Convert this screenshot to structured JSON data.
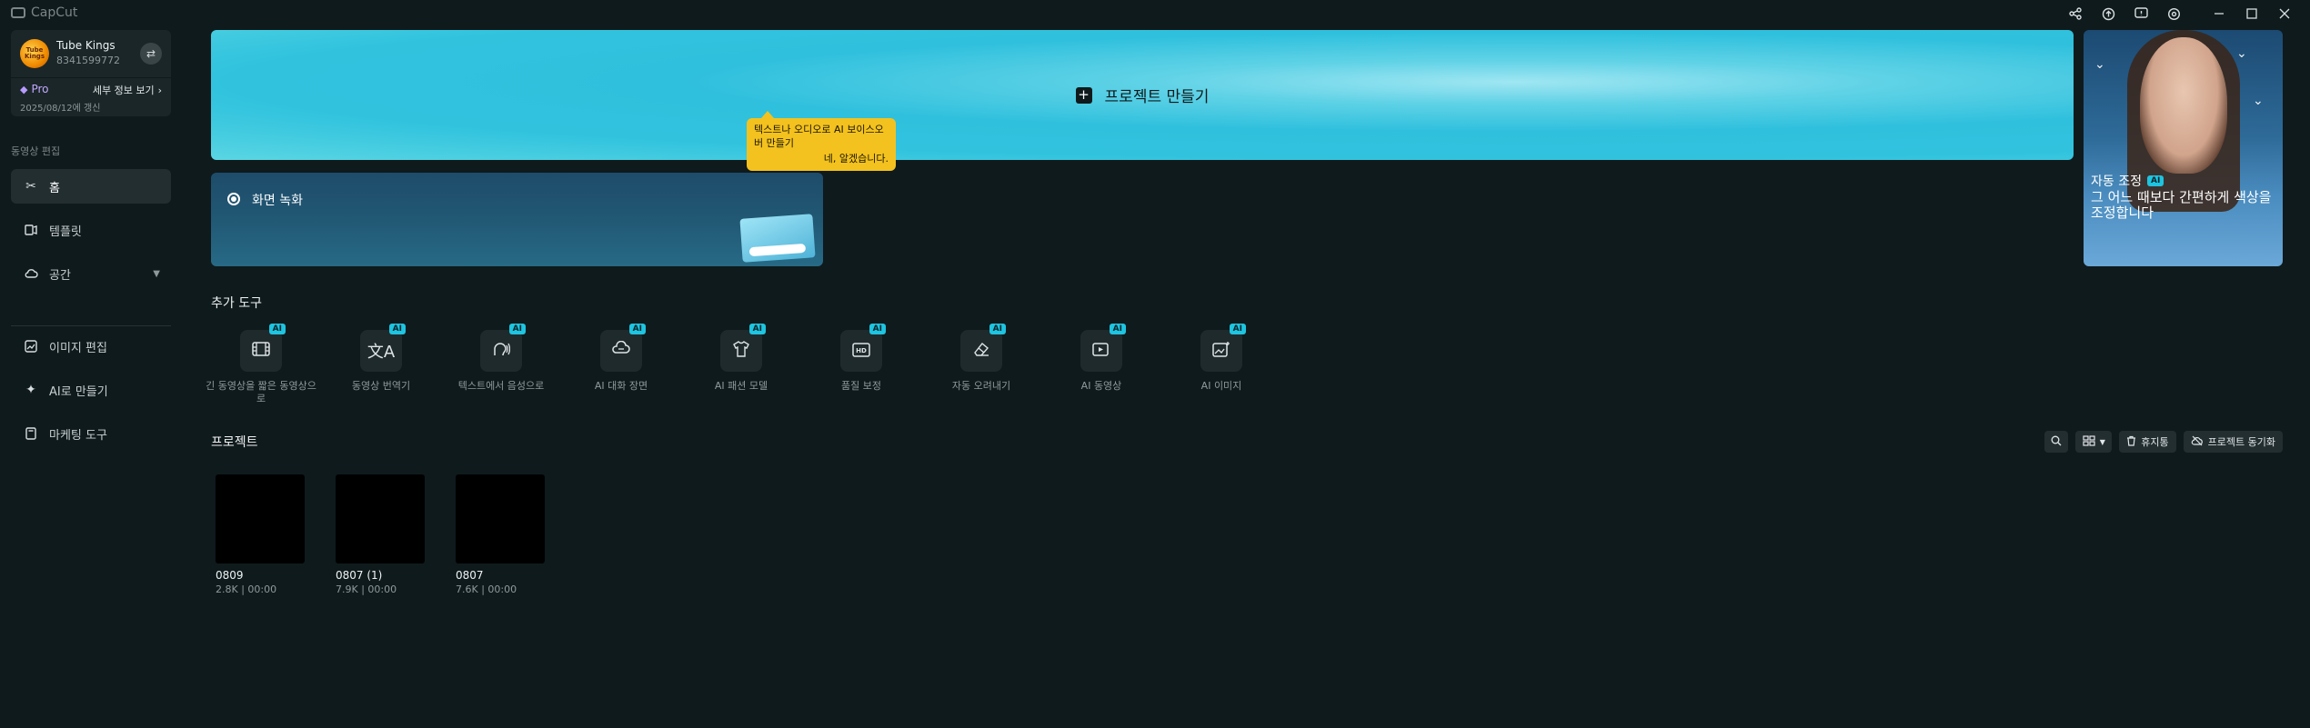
{
  "app": {
    "title": "CapCut"
  },
  "window_controls": [
    "share-icon",
    "upload-icon",
    "feedback-icon",
    "settings-icon",
    "minimize-icon",
    "maximize-icon",
    "close-icon"
  ],
  "account": {
    "avatar_text": "Tube Kings",
    "name": "Tube Kings",
    "id": "8341599772",
    "plan": "Pro",
    "detail_link": "세부 정보 보기",
    "renew_date": "2025/08/12에 갱신"
  },
  "sidebar": {
    "section_label": "동영상 편집",
    "items": [
      {
        "label": "홈",
        "icon": "scissors-icon"
      },
      {
        "label": "템플릿",
        "icon": "template-icon"
      },
      {
        "label": "공간",
        "icon": "cloud-icon"
      },
      {
        "label": "이미지 편집",
        "icon": "image-edit-icon"
      },
      {
        "label": "AI로 만들기",
        "icon": "sparkle-icon"
      },
      {
        "label": "마케팅 도구",
        "icon": "marketing-icon"
      }
    ]
  },
  "hero": {
    "create_label": "프로젝트 만들기",
    "record_label": "화면 녹화",
    "tooltip": {
      "text": "텍스트나 오디오로 AI 보이스오버 만들기",
      "ok": "네, 알겠습니다."
    },
    "promo": {
      "tag": "자동 조정",
      "badge": "AI",
      "text": "그 어느 때보다 간편하게 색상을 조정합니다"
    }
  },
  "tools": {
    "title": "추가 도구",
    "badge": "AI",
    "items": [
      {
        "label": "긴 동영상을 짧은 동영상으로",
        "icon": "film-icon"
      },
      {
        "label": "동영상 번역기",
        "icon": "translate-icon"
      },
      {
        "label": "텍스트에서 음성으로",
        "icon": "voice-icon"
      },
      {
        "label": "AI 대화 장면",
        "icon": "chat-cloud-icon"
      },
      {
        "label": "AI 패션 모델",
        "icon": "shirt-icon"
      },
      {
        "label": "품질 보정",
        "icon": "hd-icon"
      },
      {
        "label": "자동 오려내기",
        "icon": "eraser-icon"
      },
      {
        "label": "AI 동영상",
        "icon": "video-play-icon"
      },
      {
        "label": "AI 이미지",
        "icon": "image-sparkle-icon"
      }
    ]
  },
  "projects": {
    "title": "프로젝트",
    "trash_label": "휴지통",
    "sync_label": "프로젝트 동기화",
    "items": [
      {
        "name": "0809",
        "meta": "2.8K | 00:00"
      },
      {
        "name": "0807 (1)",
        "meta": "7.9K | 00:00"
      },
      {
        "name": "0807",
        "meta": "7.6K | 00:00"
      }
    ]
  },
  "colors": {
    "background": "#0f1a1c",
    "accent": "#1ec4e0",
    "tooltip": "#f4c21e"
  }
}
